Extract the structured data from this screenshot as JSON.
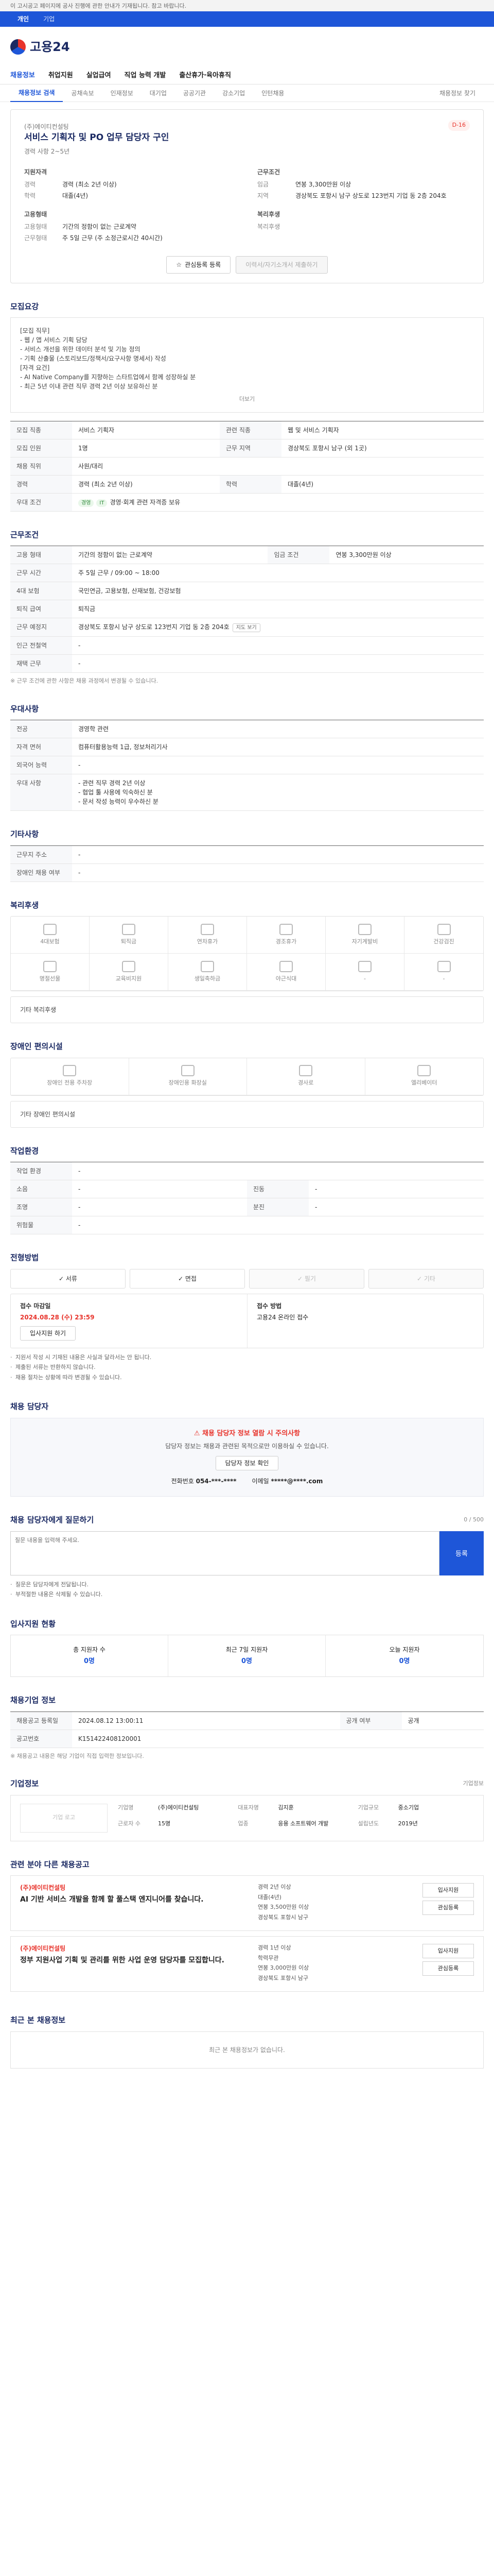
{
  "top_notice": "이 고시공고 페이지에 공사 진행에 관한 안내가 기재됩니다. 참고 바랍니다.",
  "top_tabs": [
    "개인",
    "기업"
  ],
  "logo_text": "고용24",
  "gnb": [
    "채용정보",
    "취업지원",
    "실업급여",
    "직업 능력 개발",
    "출산휴가·육아휴직"
  ],
  "subtabs": [
    "채용정보 검색",
    "공채속보",
    "인재정보",
    "대기업",
    "공공기관",
    "강소기업",
    "인턴채용"
  ],
  "subtab_right": "채용정보 찾기",
  "title": {
    "badge": "D-16",
    "company": "(주)에이티컨설팅",
    "heading": "서비스 기획자 및 PO 업무 담당자 구인",
    "sub": "경력 사항 2~5년",
    "summary": [
      {
        "heading": "지원자격",
        "rows": [
          [
            "경력",
            "경력 (최소 2년 이상)"
          ],
          [
            "학력",
            "대졸(4년)"
          ]
        ]
      },
      {
        "heading": "근무조건",
        "rows": [
          [
            "임금",
            "연봉 3,300만원 이상"
          ],
          [
            "지역",
            "경상북도 포항시 남구 상도로 123번지 기업 동 2층 204호"
          ]
        ]
      },
      {
        "heading": "고용형태",
        "rows": [
          [
            "고용형태",
            "기간의 정함이 없는 근로계약"
          ],
          [
            "근무형태",
            "주 5일 근무 (주 소정근로시간 40시간)"
          ]
        ]
      },
      {
        "heading": "복리후생",
        "rows": [
          [
            "복리후생",
            ""
          ]
        ]
      }
    ],
    "btn_scrap": "관심등록 등록",
    "btn_apply": "이력서/자기소개서 제출하기"
  },
  "job_desc": {
    "heading": "모집요강",
    "lines": [
      "[모집 직무]",
      "- 웹 / 앱 서비스 기획 담당",
      "- 서비스 개선을 위한 데이터 분석 및 기능 정의",
      "- 기획 산출물 (스토리보드/정책서/요구사항 명세서) 작성",
      "[자격 요건]",
      "- AI Native Company를 지향하는 스타트업에서 함께 성장하실 분",
      "- 최근 5년 이내 관련 직무 경력 2년 이상 보유하신 분"
    ],
    "more": "더보기",
    "table": [
      [
        "모집 직종",
        "서비스 기획자",
        "관련 직종",
        "웹 및 서비스 기획자"
      ],
      [
        "모집 인원",
        "1명",
        "근무 지역",
        "경상북도 포항시 남구 (외 1곳)"
      ],
      [
        "채용 직위",
        "사원/대리",
        "",
        ""
      ],
      [
        "경력",
        "경력 (최소 2년 이상)",
        "학력",
        "대졸(4년)"
      ],
      [
        "우대 조건",
        "경영·회계 관련 자격증 보유",
        "",
        ""
      ]
    ],
    "chips": [
      "경영",
      "IT"
    ]
  },
  "conditions": {
    "heading": "근무조건",
    "table": [
      [
        "고용 형태",
        "기간의 정함이 없는 근로계약",
        "임금 조건",
        "연봉 3,300만원 이상"
      ],
      [
        "근무 시간",
        "주 5일 근무 / 09:00 ~ 18:00",
        "",
        ""
      ],
      [
        "4대 보험",
        "국민연금, 고용보험, 산재보험, 건강보험",
        "",
        ""
      ],
      [
        "퇴직 급여",
        "퇴직금",
        "",
        ""
      ],
      [
        "근무 예정지",
        "경상북도 포항시 남구 상도로 123번지 기업 동 2층 204호",
        "",
        ""
      ],
      [
        "인근 전철역",
        "-",
        "",
        ""
      ],
      [
        "재택 근무",
        "-",
        "",
        ""
      ]
    ],
    "note": "※ 근무 조건에 관한 사항은 채용 과정에서 변경될 수 있습니다."
  },
  "skills": {
    "heading": "우대사항",
    "table": [
      [
        "전공",
        "경영학 관련"
      ],
      [
        "자격 면허",
        "컴퓨터활용능력 1급, 정보처리기사"
      ],
      [
        "외국어 능력",
        "-"
      ],
      [
        "우대 사항",
        "- 관련 직무 경력 2년 이상\n- 협업 툴 사용에 익숙하신 분\n- 문서 작성 능력이 우수하신 분"
      ]
    ]
  },
  "etc": {
    "heading": "기타사항",
    "table": [
      [
        "근무지 주소",
        "-"
      ],
      [
        "장애인 채용 여부",
        "-"
      ]
    ]
  },
  "welfare": {
    "heading": "복리후생",
    "items": [
      "4대보험",
      "퇴직금",
      "연차휴가",
      "경조휴가",
      "자기계발비",
      "건강검진",
      "명절선물",
      "교육비지원",
      "생일축하금",
      "야근식대",
      "-",
      "-"
    ],
    "extra": "기타 복리후생"
  },
  "disabled": {
    "heading": "장애인 편의시설",
    "items": [
      "장애인 전용 주차장",
      "장애인용 화장실",
      "경사로",
      "엘리베이터"
    ],
    "extra": "기타 장애인 편의시설"
  },
  "env": {
    "heading": "작업환경",
    "table": [
      [
        "작업 환경",
        "-",
        "",
        ""
      ],
      [
        "소음",
        "-",
        "진동",
        "-"
      ],
      [
        "조명",
        "-",
        "분진",
        "-"
      ],
      [
        "위험물",
        "-",
        "",
        ""
      ]
    ]
  },
  "apply": {
    "heading": "전형방법",
    "tabs": [
      "서류",
      "면접",
      "필기",
      "기타"
    ],
    "left_title": "접수 마감일",
    "left_date": "2024.08.28 (수) 23:59",
    "left_btn": "입사지원 하기",
    "right_title": "접수 방법",
    "right_value": "고용24 온라인 접수",
    "bullets": [
      "지원서 작성 시 기재된 내용은 사실과 달라서는 안 됩니다.",
      "제출된 서류는 반환하지 않습니다.",
      "채용 절차는 상황에 따라 변경될 수 있습니다."
    ]
  },
  "manager": {
    "heading": "채용 담당자",
    "warn": "채용 담당자 정보 열람 시 주의사항",
    "text": "담당자 정보는 채용과 관련된 목적으로만 이용하실 수 있습니다.",
    "btn": "담당자 정보 확인",
    "phone_label": "전화번호",
    "phone": "054-***-****",
    "email_label": "이메일",
    "email": "*****@****.com"
  },
  "qa": {
    "heading": "채용 담당자에게 질문하기",
    "placeholder": "질문 내용을 입력해 주세요.",
    "counter": "0 / 500",
    "submit": "등록",
    "bullets": [
      "질문은 담당자에게 전달됩니다.",
      "부적절한 내용은 삭제될 수 있습니다."
    ]
  },
  "status": {
    "heading": "입사지원 현황",
    "cells": [
      [
        "총 지원자 수",
        "0명"
      ],
      [
        "최근 7일 지원자",
        "0명"
      ],
      [
        "오늘 지원자",
        "0명"
      ]
    ]
  },
  "reg": {
    "heading": "채용기업 정보",
    "table": [
      [
        "채용공고 등록일",
        "2024.08.12 13:00:11",
        "공개 여부",
        "공개"
      ],
      [
        "공고번호",
        "K151422408120001",
        "",
        ""
      ]
    ],
    "note": "※ 채용공고 내용은 해당 기업이 직접 입력한 정보입니다."
  },
  "company": {
    "heading": "기업정보",
    "more": "기업정보",
    "logo": "기업 로고",
    "name_label": "기업명",
    "name": "(주)에이티컨설팅",
    "ceo_label": "대표자명",
    "ceo": "김지훈",
    "size_label": "기업규모",
    "size": "중소기업",
    "emp_label": "근로자 수",
    "emp": "15명",
    "ind_label": "업종",
    "ind": "응용 소프트웨어 개발",
    "found_label": "설립년도",
    "found": "2019년"
  },
  "related": {
    "heading": "관련 분야 다른 채용공고",
    "items": [
      {
        "company": "(주)에이티컨설팅",
        "title": "AI 기반 서비스 개발을 함께 할 풀스택 엔지니어를 찾습니다.",
        "meta": [
          "경력 2년 이상",
          "대졸(4년)",
          "연봉 3,500만원 이상",
          "경상북도 포항시 남구"
        ],
        "btn1": "입사지원",
        "btn2": "관심등록"
      },
      {
        "company": "(주)에이티컨설팅",
        "title": "정부 지원사업 기획 및 관리를 위한 사업 운영 담당자를 모집합니다.",
        "meta": [
          "경력 1년 이상",
          "학력무관",
          "연봉 3,000만원 이상",
          "경상북도 포항시 남구"
        ],
        "btn1": "입사지원",
        "btn2": "관심등록"
      }
    ]
  },
  "recent": {
    "heading": "최근 본 채용정보",
    "empty": "최근 본 채용정보가 없습니다."
  }
}
